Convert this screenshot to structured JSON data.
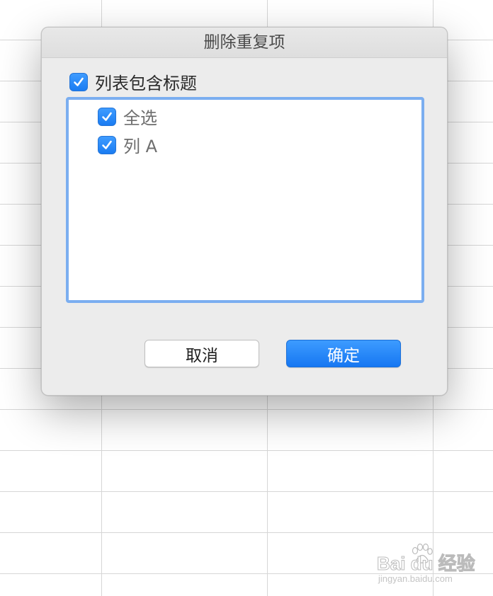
{
  "dialog": {
    "title": "删除重复项",
    "header_checkbox": {
      "label": "列表包含标题",
      "checked": true
    },
    "list_items": [
      {
        "label": "全选",
        "checked": true
      },
      {
        "label": "列 A",
        "checked": true
      }
    ],
    "buttons": {
      "cancel_label": "取消",
      "ok_label": "确定"
    }
  },
  "colors": {
    "accent": "#1a7cf2",
    "list_border": "#7baef0",
    "dialog_bg": "#ececec"
  },
  "watermark": {
    "main": "Bai du 经验",
    "sub": "jingyan.baidu.com"
  }
}
